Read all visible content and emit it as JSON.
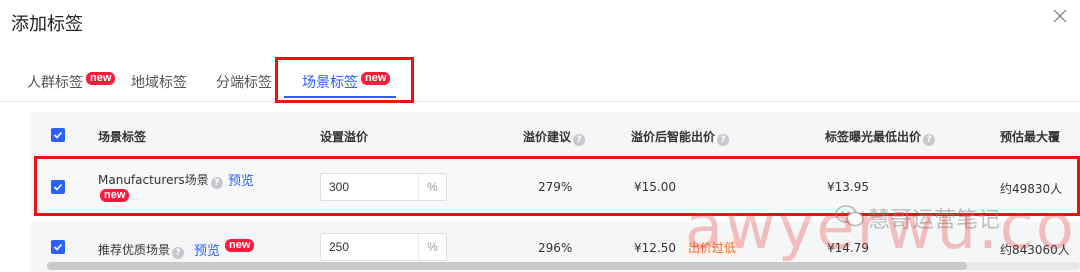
{
  "dialog": {
    "title": "添加标签"
  },
  "tabs": [
    {
      "label": "人群标签",
      "badge": "new"
    },
    {
      "label": "地域标签",
      "badge": ""
    },
    {
      "label": "分端标签",
      "badge": ""
    },
    {
      "label": "场景标签",
      "badge": "new",
      "active": true
    }
  ],
  "table": {
    "headers": [
      "场景标签",
      "设置溢价",
      "溢价建议",
      "溢价后智能出价",
      "标签曝光最低出价",
      "预估最大覆"
    ],
    "rows": [
      {
        "checked": true,
        "name": "Manufacturers场景",
        "preview": "预览",
        "badge": "new",
        "premium_value": "300",
        "suffix": "%",
        "suggestion": "279%",
        "smart_bid": "¥15.00",
        "over_tag": "",
        "min_bid": "¥13.95",
        "coverage": "约49830人"
      },
      {
        "checked": true,
        "name": "推荐优质场景",
        "preview": "预览",
        "badge": "new",
        "premium_value": "250",
        "suffix": "%",
        "suggestion": "296%",
        "smart_bid": "¥12.50",
        "over_tag": "出价过低",
        "min_bid": "¥14.79",
        "coverage": "约843060人"
      }
    ]
  },
  "watermark": {
    "text": "awyerwu.com",
    "source": "慧哥运营笔记"
  },
  "colors": {
    "accent": "#2b62ff",
    "badge": "#ff1a3c",
    "highlight": "#ee1111",
    "warning": "#ff6a2a"
  }
}
